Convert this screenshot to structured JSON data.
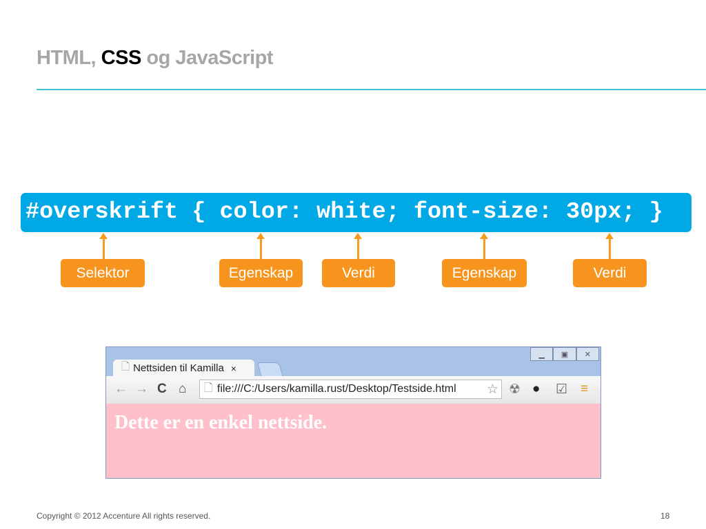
{
  "title": {
    "part1": "HTML, ",
    "part2": "CSS",
    "part3": " og JavaScript"
  },
  "code": "#overskrift { color: white; font-size: 30px; }",
  "labels": [
    "Selektor",
    "Egenskap",
    "Verdi",
    "Egenskap",
    "Verdi"
  ],
  "browser": {
    "tab_title": "Nettsiden til Kamilla",
    "tab_close": "×",
    "url": "file:///C:/Users/kamilla.rust/Desktop/Testside.html",
    "page_heading": "Dette er en enkel nettside."
  },
  "footer": {
    "copyright": "Copyright © 2012 Accenture  All rights reserved.",
    "page": "18"
  },
  "colors": {
    "code_bg": "#00a8e6",
    "tag_bg": "#f7941d",
    "page_bg": "#ffc0cb",
    "rule": "#3cc3d6"
  }
}
